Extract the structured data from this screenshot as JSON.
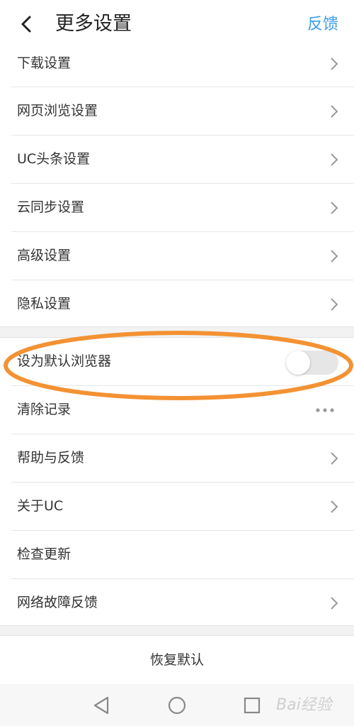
{
  "header": {
    "title": "更多设置",
    "feedback_label": "反馈",
    "back_icon": "chevron-left-icon"
  },
  "group1": {
    "items": [
      {
        "label": "下载设置"
      },
      {
        "label": "网页浏览设置"
      },
      {
        "label": "UC头条设置"
      },
      {
        "label": "云同步设置"
      },
      {
        "label": "高级设置"
      },
      {
        "label": "隐私设置"
      }
    ]
  },
  "group2": {
    "items": [
      {
        "label": "设为默认浏览器",
        "control": "toggle",
        "toggle_on": false
      },
      {
        "label": "清除记录",
        "control": "more"
      },
      {
        "label": "帮助与反馈",
        "control": "chevron"
      },
      {
        "label": "关于UC",
        "control": "chevron"
      },
      {
        "label": "检查更新",
        "control": "none"
      },
      {
        "label": "网络故障反馈",
        "control": "chevron"
      }
    ]
  },
  "restore_label": "恢复默认",
  "colors": {
    "accent": "#3b9de8",
    "annotation": "#f39233"
  },
  "watermark": {
    "text": "Bai经验"
  }
}
